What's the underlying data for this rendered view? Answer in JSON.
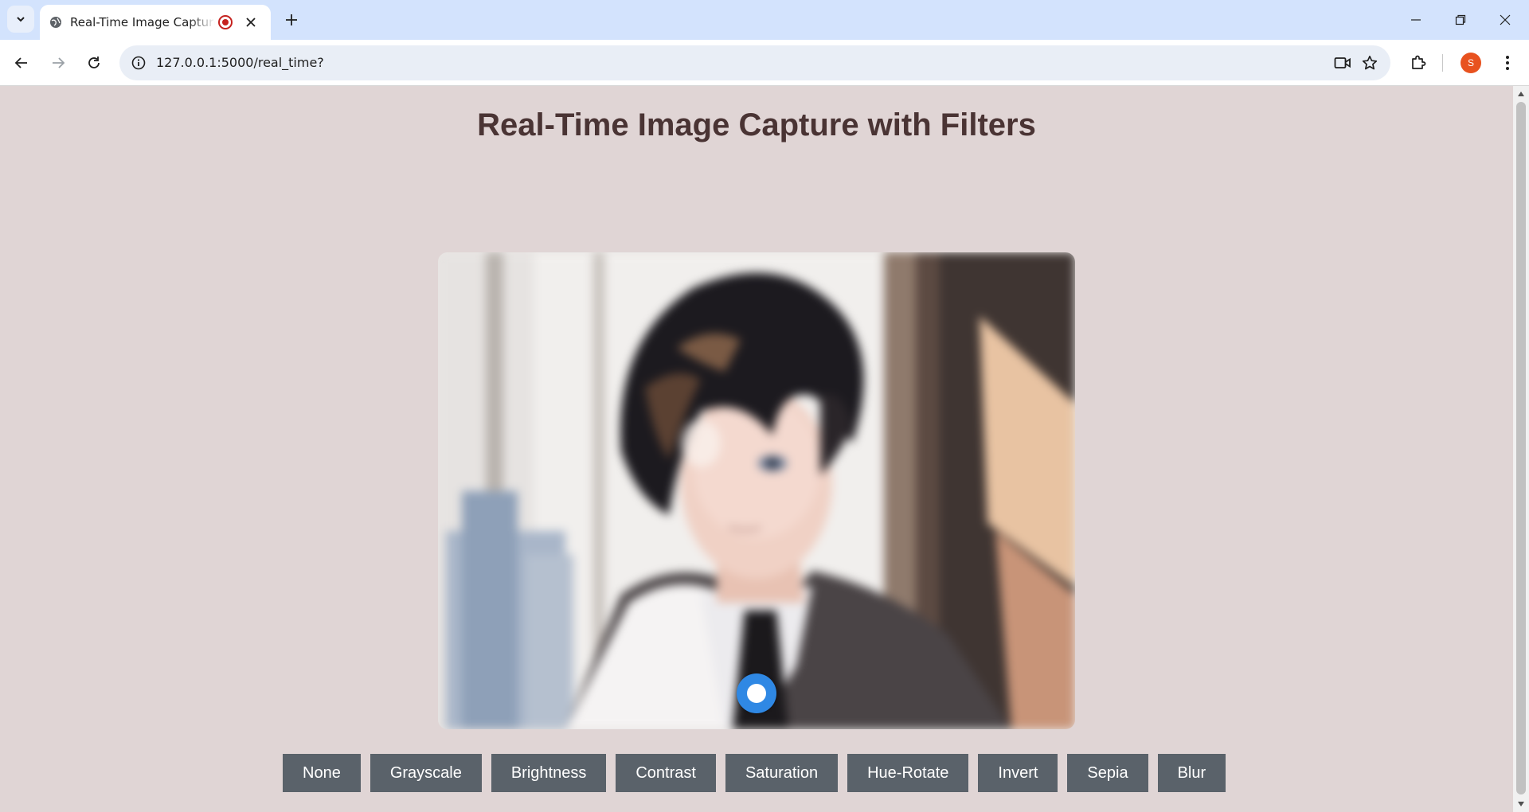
{
  "browser": {
    "tab_title": "Real-Time Image Capture with Filters",
    "url": "127.0.0.1:5000/real_time?",
    "profile_initial": "S",
    "tab_icon": "globe-icon",
    "recording_indicator": "record-icon"
  },
  "page": {
    "title": "Real-Time Image Capture with Filters",
    "background": "#e0d5d5",
    "title_color": "#4a3434",
    "button_color": "#5a626a"
  },
  "filters": [
    {
      "label": "None"
    },
    {
      "label": "Grayscale"
    },
    {
      "label": "Brightness"
    },
    {
      "label": "Contrast"
    },
    {
      "label": "Saturation"
    },
    {
      "label": "Hue-Rotate"
    },
    {
      "label": "Invert"
    },
    {
      "label": "Sepia"
    },
    {
      "label": "Blur"
    }
  ]
}
